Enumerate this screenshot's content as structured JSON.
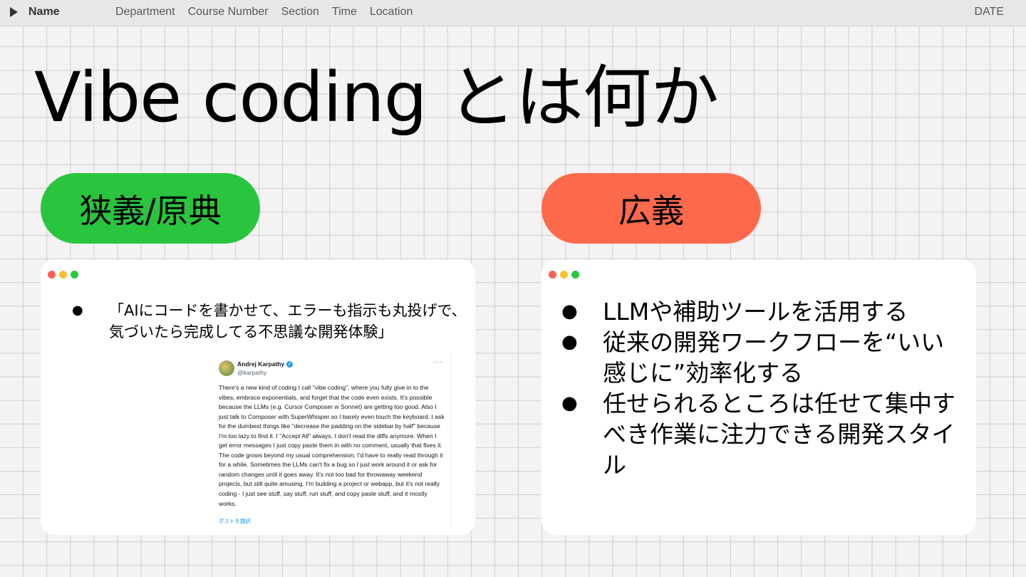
{
  "topbar": {
    "name": "Name",
    "nav": [
      "Department",
      "Course Number",
      "Section",
      "Time",
      "Location"
    ],
    "date": "DATE"
  },
  "title": "Vibe coding とは何か",
  "left": {
    "pill_label": "狭義/原典",
    "pill_color": "#2ac53f",
    "bullet": "「AIにコードを書かせて、エラーも指示も丸投げで、気づいたら完成してる不思議な開発体験」",
    "tweet": {
      "author": "Andrej Karpathy",
      "handle": "@karpathy",
      "text": "There's a new kind of coding I call \"vibe coding\", where you fully give in to the vibes, embrace exponentials, and forget that the code even exists. It's possible because the LLMs (e.g. Cursor Composer w Sonnet) are getting too good. Also I just talk to Composer with SuperWhisper so I barely even touch the keyboard. I ask for the dumbest things like \"decrease the padding on the sidebar by half\" because I'm too lazy to find it. I \"Accept All\" always, I don't read the diffs anymore. When I get error messages I just copy paste them in with no comment, usually that fixes it. The code grows beyond my usual comprehension, I'd have to really read through it for a while. Sometimes the LLMs can't fix a bug so I just work around it or ask for random changes until it goes away. It's not too bad for throwaway weekend projects, but still quite amusing. I'm building a project or webapp, but it's not really coding - I just see stuff, say stuff, run stuff, and copy paste stuff, and it mostly works.",
      "translate": "ポストを翻訳"
    }
  },
  "right": {
    "pill_label": "広義",
    "pill_color": "#fd6a4b",
    "bullets": [
      "LLMや補助ツールを活用する",
      "従来の開発ワークフローを“いい感じに”効率化する",
      "任せられるところは任せて集中すべき作業に注力できる開発スタイル"
    ]
  }
}
